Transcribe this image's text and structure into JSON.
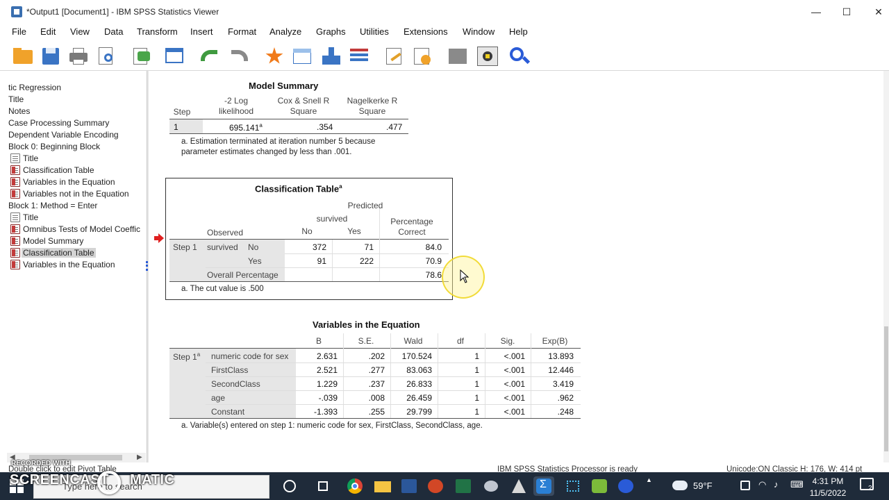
{
  "window": {
    "title": "*Output1 [Document1] - IBM SPSS Statistics Viewer",
    "minimize": "—",
    "maximize": "☐",
    "close": "✕"
  },
  "menu": [
    "File",
    "Edit",
    "View",
    "Data",
    "Transform",
    "Insert",
    "Format",
    "Analyze",
    "Graphs",
    "Utilities",
    "Extensions",
    "Window",
    "Help"
  ],
  "toolbar_icons": [
    "open-folder-icon",
    "save-icon",
    "print-icon",
    "print-preview-icon",
    "export-icon",
    "recall-dialog-icon",
    "undo-icon",
    "redo-icon",
    "goto-case-icon",
    "goto-variable-icon",
    "variables-icon",
    "value-labels-icon",
    "edit-icon",
    "designate-window-icon",
    "hidden-icon",
    "insert-output-icon",
    "find-icon"
  ],
  "outline": {
    "items": [
      {
        "label": "tic Regression",
        "icon": "none"
      },
      {
        "label": "Title",
        "icon": "none"
      },
      {
        "label": "Notes",
        "icon": "none"
      },
      {
        "label": "Case Processing Summary",
        "icon": "none"
      },
      {
        "label": "Dependent Variable Encoding",
        "icon": "none"
      },
      {
        "label": "Block 0: Beginning Block",
        "icon": "none"
      },
      {
        "label": "Title",
        "icon": "text"
      },
      {
        "label": "Classification Table",
        "icon": "table"
      },
      {
        "label": "Variables in the Equation",
        "icon": "table"
      },
      {
        "label": "Variables not in the Equation",
        "icon": "table"
      },
      {
        "label": "Block 1: Method = Enter",
        "icon": "none"
      },
      {
        "label": "Title",
        "icon": "text"
      },
      {
        "label": "Omnibus Tests of Model Coeffic",
        "icon": "table"
      },
      {
        "label": "Model Summary",
        "icon": "table"
      },
      {
        "label": "Classification Table",
        "icon": "table"
      },
      {
        "label": "Variables in the Equation",
        "icon": "table"
      }
    ],
    "selected_index": 14
  },
  "model_summary": {
    "title": "Model Summary",
    "headers": {
      "step": "Step",
      "log_lik": "-2 Log likelihood",
      "cox": "Cox & Snell R Square",
      "nagel": "Nagelkerke R Square"
    },
    "row": {
      "step": "1",
      "log_lik": "695.141",
      "log_lik_sup": "a",
      "cox": ".354",
      "nagel": ".477"
    },
    "footnote": "a. Estimation terminated at iteration number 5 because parameter estimates changed by less than .001."
  },
  "classification": {
    "title": "Classification Table",
    "title_sup": "a",
    "predicted": "Predicted",
    "survived": "survived",
    "pct_correct": "Percentage Correct",
    "observed": "Observed",
    "no": "No",
    "yes": "Yes",
    "step": "Step 1",
    "var": "survived",
    "rows": [
      {
        "label": "No",
        "no": "372",
        "yes": "71",
        "pct": "84.0"
      },
      {
        "label": "Yes",
        "no": "91",
        "yes": "222",
        "pct": "70.9"
      }
    ],
    "overall_label": "Overall Percentage",
    "overall_pct": "78.6",
    "footnote": "a. The cut value is .500"
  },
  "variables": {
    "title": "Variables in the Equation",
    "headers": [
      "B",
      "S.E.",
      "Wald",
      "df",
      "Sig.",
      "Exp(B)"
    ],
    "step": "Step 1",
    "step_sup": "a",
    "rows": [
      {
        "name": "numeric code for sex",
        "b": "2.631",
        "se": ".202",
        "wald": "170.524",
        "df": "1",
        "sig": "<.001",
        "expb": "13.893"
      },
      {
        "name": "FirstClass",
        "b": "2.521",
        "se": ".277",
        "wald": "83.063",
        "df": "1",
        "sig": "<.001",
        "expb": "12.446"
      },
      {
        "name": "SecondClass",
        "b": "1.229",
        "se": ".237",
        "wald": "26.833",
        "df": "1",
        "sig": "<.001",
        "expb": "3.419"
      },
      {
        "name": "age",
        "b": "-.039",
        "se": ".008",
        "wald": "26.459",
        "df": "1",
        "sig": "<.001",
        "expb": ".962"
      },
      {
        "name": "Constant",
        "b": "-1.393",
        "se": ".255",
        "wald": "29.799",
        "df": "1",
        "sig": "<.001",
        "expb": ".248"
      }
    ],
    "footnote": "a. Variable(s) entered on step 1: numeric code for sex, FirstClass, SecondClass, age."
  },
  "status": {
    "left": "Double click to edit Pivot Table",
    "processor": "IBM SPSS Statistics Processor is ready",
    "right": "Unicode:ON  Classic  H: 176, W: 414 pt"
  },
  "taskbar": {
    "search_placeholder": "Type here to search",
    "temp": "59°F",
    "time": "4:31 PM",
    "date": "11/5/2022",
    "notifications": "2"
  },
  "watermark": {
    "top": "RECORDED WITH",
    "main": "SCREENCAST",
    "main2": "MATIC"
  },
  "colors": {
    "accent": "#2a5bd7",
    "shade": "#e6e6e6",
    "taskbar": "#1f2b3a"
  }
}
